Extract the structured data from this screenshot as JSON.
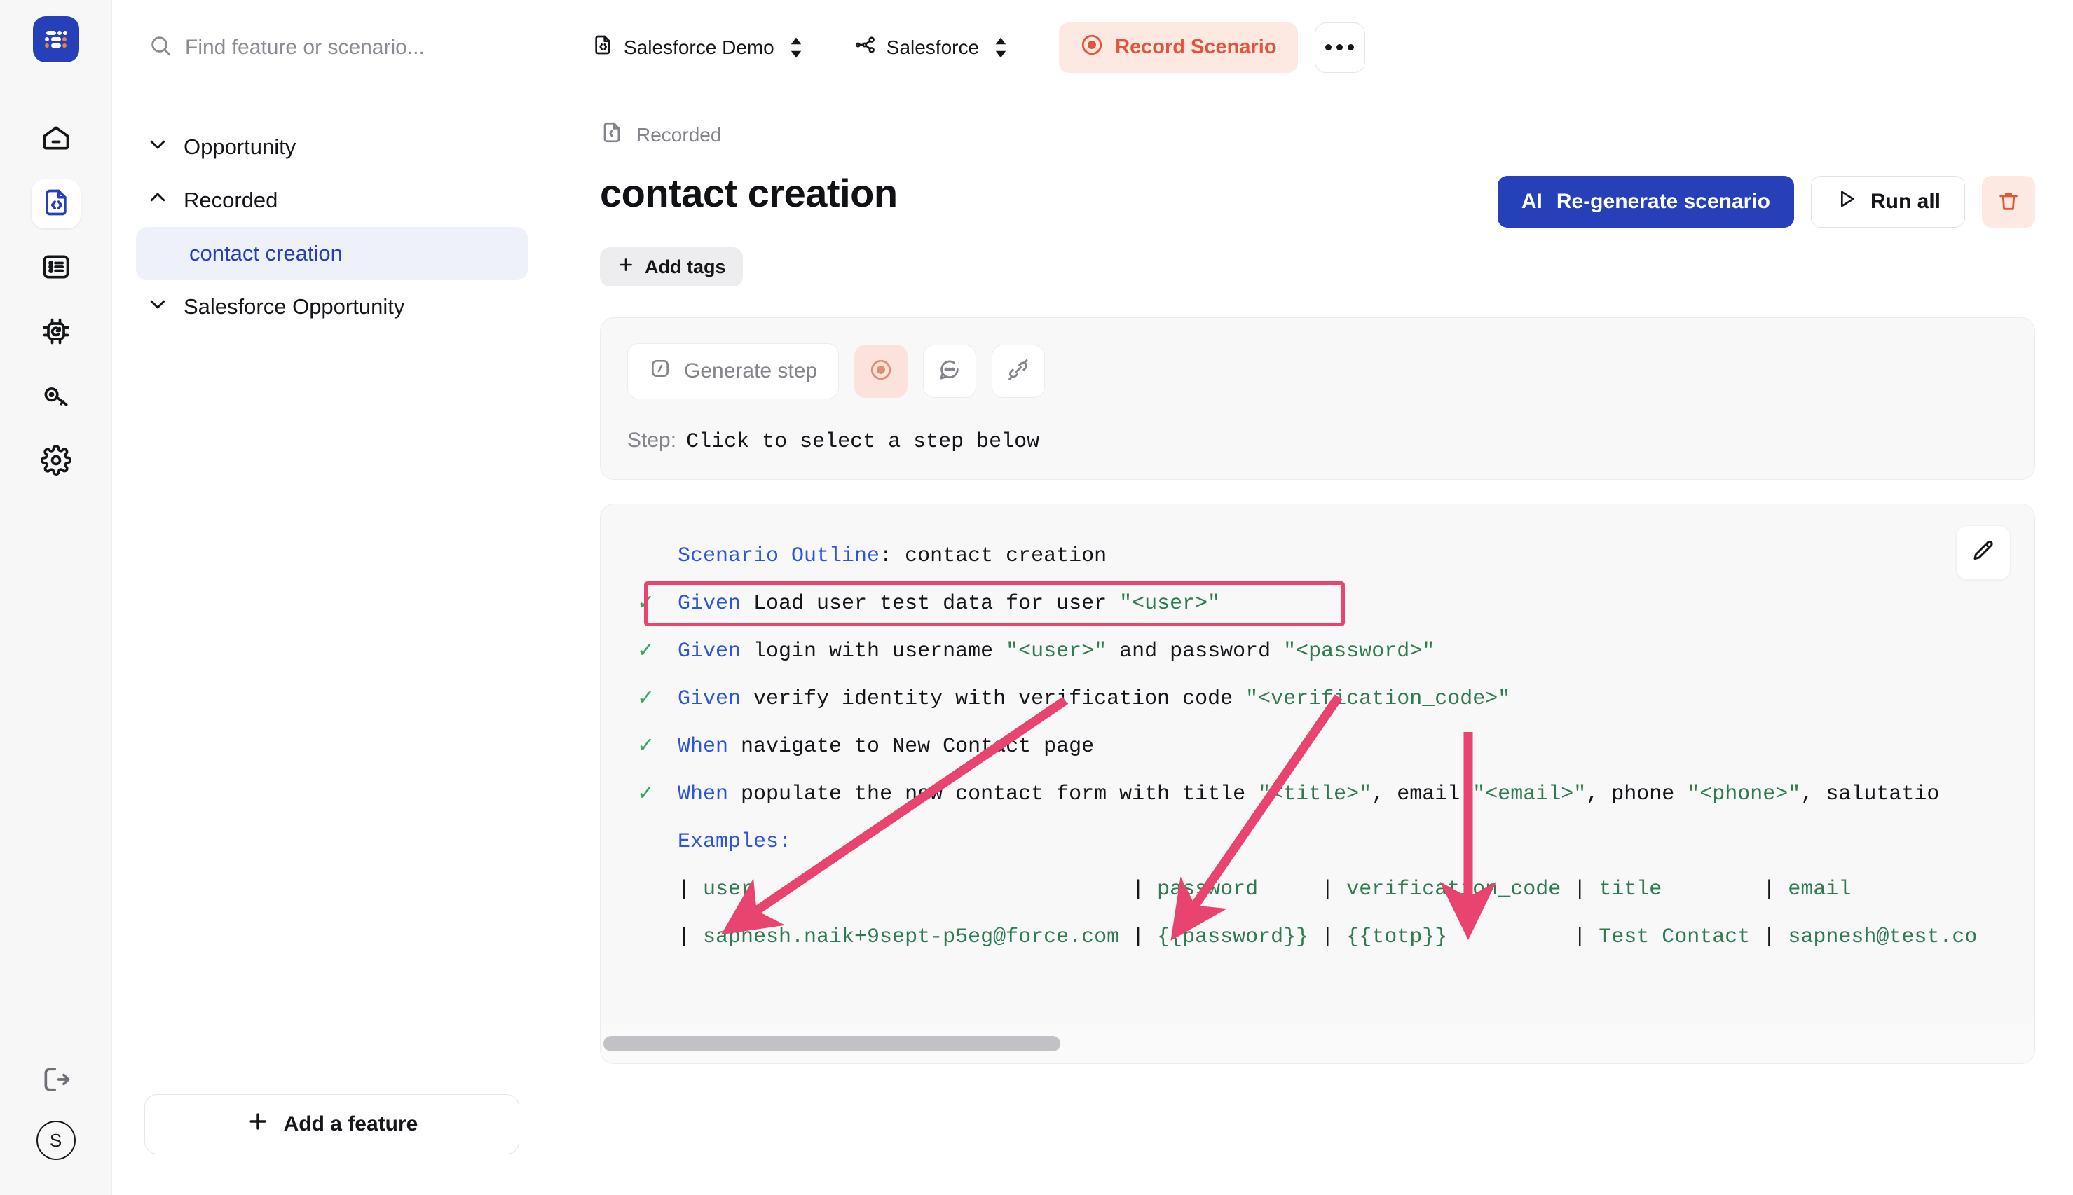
{
  "brand": {
    "logo_color": "#2540b8",
    "accent_blue": "#2540b8",
    "accent_red": "#e2553a",
    "green": "#2f7d4f",
    "annotation_pink": "#e8446f"
  },
  "search": {
    "placeholder": "Find feature or scenario...",
    "value": "",
    "icon": "search-icon"
  },
  "topbar": {
    "project": {
      "label": "Salesforce Demo",
      "icon": "code-file-icon"
    },
    "workspace": {
      "label": "Salesforce",
      "icon": "org-tree-icon"
    },
    "record_button": {
      "label": "Record Scenario",
      "icon": "record-target-icon"
    },
    "more_button": {
      "label": "..."
    }
  },
  "rail": {
    "items": [
      {
        "name": "home-icon",
        "label": "Home",
        "active": false
      },
      {
        "name": "code-file-icon",
        "label": "Scenarios",
        "active": true
      },
      {
        "name": "list-icon",
        "label": "Runs",
        "active": false
      },
      {
        "name": "chip-icon",
        "label": "Agents",
        "active": false
      },
      {
        "name": "key-icon",
        "label": "Credentials",
        "active": false
      },
      {
        "name": "gear-icon",
        "label": "Settings",
        "active": false
      }
    ],
    "logout": {
      "name": "logout-icon",
      "label": "Log out"
    },
    "avatar": {
      "initial": "S"
    }
  },
  "tree": {
    "items": [
      {
        "label": "Opportunity",
        "chevron": "chevron-down-icon",
        "selected": false,
        "indent": false
      },
      {
        "label": "Recorded",
        "chevron": "chevron-up-icon",
        "selected": false,
        "indent": false
      },
      {
        "label": "contact creation",
        "chevron": "",
        "selected": true,
        "indent": true
      },
      {
        "label": "Salesforce Opportunity",
        "chevron": "chevron-down-icon",
        "selected": false,
        "indent": false
      }
    ],
    "add_feature_label": "Add a feature"
  },
  "main": {
    "breadcrumb": {
      "icon": "code-file-icon",
      "label": "Recorded"
    },
    "title": "contact creation",
    "actions": {
      "regenerate": {
        "prefix": "AI",
        "label": "Re-generate scenario"
      },
      "run_all": {
        "label": "Run all",
        "icon": "play-icon"
      },
      "delete": {
        "icon": "trash-icon"
      }
    },
    "add_tags_label": "Add tags",
    "generator": {
      "generate_step_label": "Generate step",
      "generate_step_icon": "magic-code-icon",
      "tools": [
        {
          "name": "record-target-icon",
          "active": true
        },
        {
          "name": "comment-icon",
          "active": false
        },
        {
          "name": "link-broken-icon",
          "active": false
        }
      ],
      "step_label": "Step:",
      "step_value": "Click to select a step below"
    },
    "code_edit_icon": "pencil-icon"
  },
  "gherkin": {
    "outline_keyword": "Scenario Outline",
    "outline_name": "contact creation",
    "steps": [
      {
        "status": "pass",
        "keyword": "Given",
        "before": "Load user test data for user ",
        "quoted": "\"<user>\"",
        "after": "",
        "highlighted": true
      },
      {
        "status": "pass",
        "keyword": "Given",
        "before": "login with username ",
        "quoted": "\"<user>\"",
        "mid": " and password ",
        "quoted2": "\"<password>\"",
        "after": "",
        "highlighted": false
      },
      {
        "status": "pass",
        "keyword": "Given",
        "before": "verify identity with verification code ",
        "quoted": "\"<verification_code>\"",
        "after": "",
        "highlighted": false
      },
      {
        "status": "pass",
        "keyword": "When",
        "before": "navigate to New Contact page",
        "quoted": "",
        "after": "",
        "highlighted": false
      },
      {
        "status": "pass",
        "keyword": "When",
        "before": "populate the new contact form with title ",
        "quoted": "\"<title>\"",
        "mid": ", email ",
        "quoted2": "\"<email>\"",
        "mid2": ", phone ",
        "quoted3": "\"<phone>\"",
        "after": ", salutatio",
        "highlighted": false
      }
    ],
    "examples_keyword": "Examples:",
    "examples_header": [
      "user",
      "password",
      "verification_code",
      "title",
      "email"
    ],
    "examples_rows": [
      [
        "sapnesh.naik+9sept-p5eg@force.com",
        "{{password}}",
        "{{totp}}",
        "Test Contact",
        "sapnesh@test.co"
      ]
    ]
  },
  "annotations": {
    "highlight_box": {
      "target": "given-load-user-test-data-step",
      "color": "#e8446f"
    },
    "arrows": [
      {
        "from": "given-login-username-token",
        "to": "examples-column-user"
      },
      {
        "from": "given-login-password-token",
        "to": "examples-column-password"
      },
      {
        "from": "verification-code-token",
        "to": "examples-column-verification-code"
      }
    ]
  }
}
